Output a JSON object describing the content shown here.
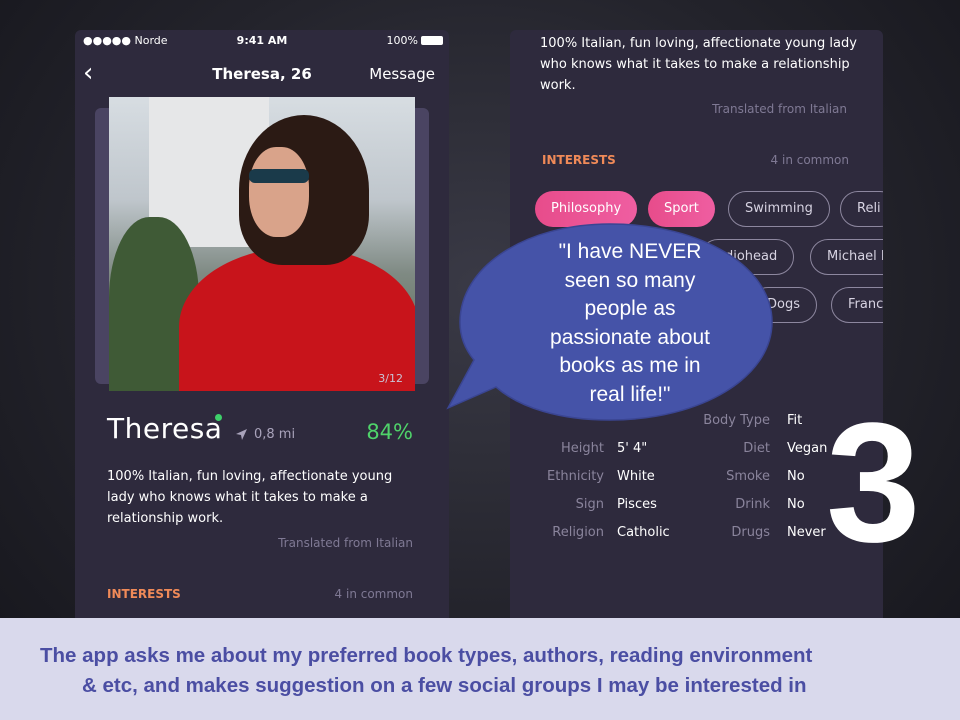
{
  "left_phone": {
    "status": {
      "carrier": "●●●●● Norde",
      "time": "9:41 AM",
      "battery": "100%"
    },
    "nav": {
      "back": "‹",
      "title": "Theresa, 26",
      "action": "Message"
    },
    "photo_counter": "3/12",
    "profile": {
      "name": "Theresa",
      "distance": "0,8 mi",
      "match": "84%",
      "bio": "100% Italian, fun loving, affectionate young lady who knows what it takes to make a relationship work.",
      "translated": "Translated from Italian"
    },
    "interests": {
      "label": "INTERESTS",
      "common": "4 in common"
    }
  },
  "right_phone": {
    "bio": "100% Italian, fun loving, affectionate young lady who knows what it takes to make a relationship work.",
    "translated": "Translated from Italian",
    "interests": {
      "label": "INTERESTS",
      "common": "4 in common",
      "chips": [
        {
          "label": "Philosophy",
          "active": true
        },
        {
          "label": "Sport",
          "active": true
        },
        {
          "label": "Swimming",
          "active": false
        },
        {
          "label": "Reli",
          "active": false
        },
        {
          "label": "adiohead",
          "active": false
        },
        {
          "label": "Michael B",
          "active": false
        },
        {
          "label": "Dogs",
          "active": false
        },
        {
          "label": "Franc",
          "active": false
        }
      ]
    },
    "attributes": {
      "body_type": {
        "label": "Body Type",
        "value": "Fit"
      },
      "height": {
        "label": "Height",
        "value": "5' 4\""
      },
      "diet": {
        "label": "Diet",
        "value": "Vegan"
      },
      "ethnicity": {
        "label": "Ethnicity",
        "value": "White"
      },
      "smoke": {
        "label": "Smoke",
        "value": "No"
      },
      "sign": {
        "label": "Sign",
        "value": "Pisces"
      },
      "drink": {
        "label": "Drink",
        "value": "No"
      },
      "religion": {
        "label": "Religion",
        "value": "Catholic"
      },
      "drugs": {
        "label": "Drugs",
        "value": "Never"
      }
    }
  },
  "bubble": {
    "lines": [
      "\"I have NEVER",
      "seen so many",
      "people as",
      "passionate about",
      "books as me in",
      "real life!\""
    ]
  },
  "big_number": "3",
  "caption": {
    "line1": "The app asks me about my preferred book types, authors, reading environment",
    "line2": "& etc, and makes suggestion on a few social groups I may be interested in"
  },
  "colors": {
    "accent_pink": "#e74c8b",
    "match_green": "#4fd26a",
    "interests_orange": "#f08a58",
    "bubble_blue": "#4553a8",
    "caption_text": "#4b4ea3"
  }
}
